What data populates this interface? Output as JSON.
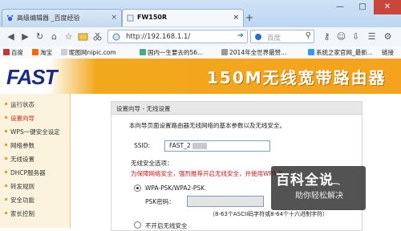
{
  "browser": {
    "tabs": [
      {
        "label": "高级编辑器 _百度经验",
        "close": "×"
      },
      {
        "label": "FW150R",
        "close": "×"
      }
    ],
    "new_tab": "+",
    "window_controls": {
      "minimize": "—",
      "maximize": "□",
      "close": "✕"
    },
    "nav": {
      "back": "◀",
      "forward": "▶",
      "refresh": "↻",
      "home": "⌂",
      "favorite": "☆"
    },
    "address": "http://192.168.1.1/",
    "search_engine": "百度",
    "search_placeholder": "",
    "bookmarks": [
      "百度",
      "淘宝",
      "昵图网nipic.com",
      "国内一生要去的56...",
      "2014年全世界最赞...",
      "系统之家官网_最新...",
      "链接"
    ],
    "colors": {
      "chrome": "#bcd6f1",
      "close": "#c7473a"
    }
  },
  "router": {
    "logo": "FAST",
    "banner": "150M无线宽带路由器",
    "nav_items": [
      "运行状态",
      "设置向导",
      "WPS一键安全设定",
      "网络参数",
      "无线设置",
      "DHCP服务器",
      "转发规则",
      "安全功能",
      "家长控制"
    ],
    "active_nav": "设置向导",
    "panel": {
      "title": "设置向导 - 无线设置",
      "intro": "本向导页面设置路由器无线网络的基本参数以及无线安全。",
      "ssid_label": "SSID:",
      "ssid_value": "FAST_2",
      "security_heading": "无线安全选项：",
      "security_warning": "为保障网络安全，强烈推荐开启无线安全，并使用WPA-P",
      "option_wpa": "WPA-PSK/WPA2-PSK",
      "psk_label": "PSK密码：",
      "psk_hint": "（8-63个ASCII码字符或8-64个十六进制字符）",
      "option_off": "不开启无线安全"
    },
    "colors": {
      "orange": "#f5a31c",
      "logo": "#1a2a8a",
      "warning": "#d01818"
    }
  },
  "watermark": {
    "title": "百科全说",
    "subtitle": "助你轻松解决"
  }
}
